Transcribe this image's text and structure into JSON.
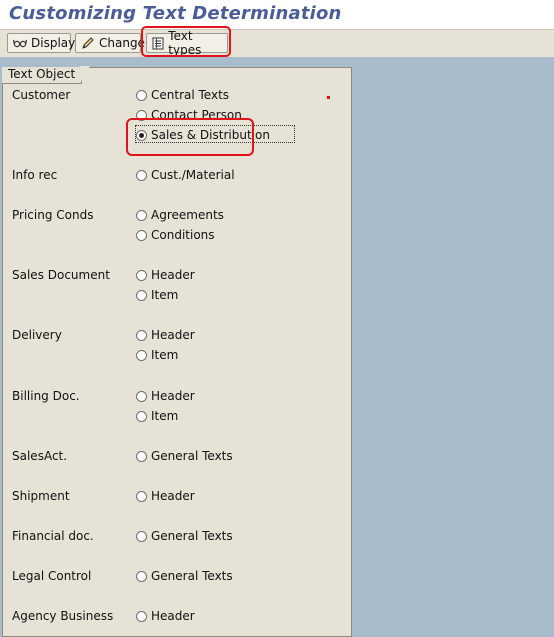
{
  "title": "Customizing Text Determination",
  "toolbar": {
    "display": "Display",
    "change": "Change",
    "text_types": "Text types"
  },
  "panel": {
    "tab_label": "Text Object",
    "groups": [
      {
        "label": "Customer",
        "options": [
          "Central Texts",
          "Contact Person",
          "Sales & Distribution"
        ],
        "selected": "Sales & Distribution"
      },
      {
        "label": "Info rec",
        "options": [
          "Cust./Material"
        ]
      },
      {
        "label": "Pricing Conds",
        "options": [
          "Agreements",
          "Conditions"
        ]
      },
      {
        "label": "Sales Document",
        "options": [
          "Header",
          "Item"
        ]
      },
      {
        "label": "Delivery",
        "options": [
          "Header",
          "Item"
        ]
      },
      {
        "label": "Billing Doc.",
        "options": [
          "Header",
          "Item"
        ]
      },
      {
        "label": "SalesAct.",
        "options": [
          "General Texts"
        ]
      },
      {
        "label": "Shipment",
        "options": [
          "Header"
        ]
      },
      {
        "label": "Financial doc.",
        "options": [
          "General Texts"
        ]
      },
      {
        "label": "Legal Control",
        "options": [
          "General Texts"
        ]
      },
      {
        "label": "Agency Business",
        "options": [
          "Header"
        ]
      }
    ]
  }
}
